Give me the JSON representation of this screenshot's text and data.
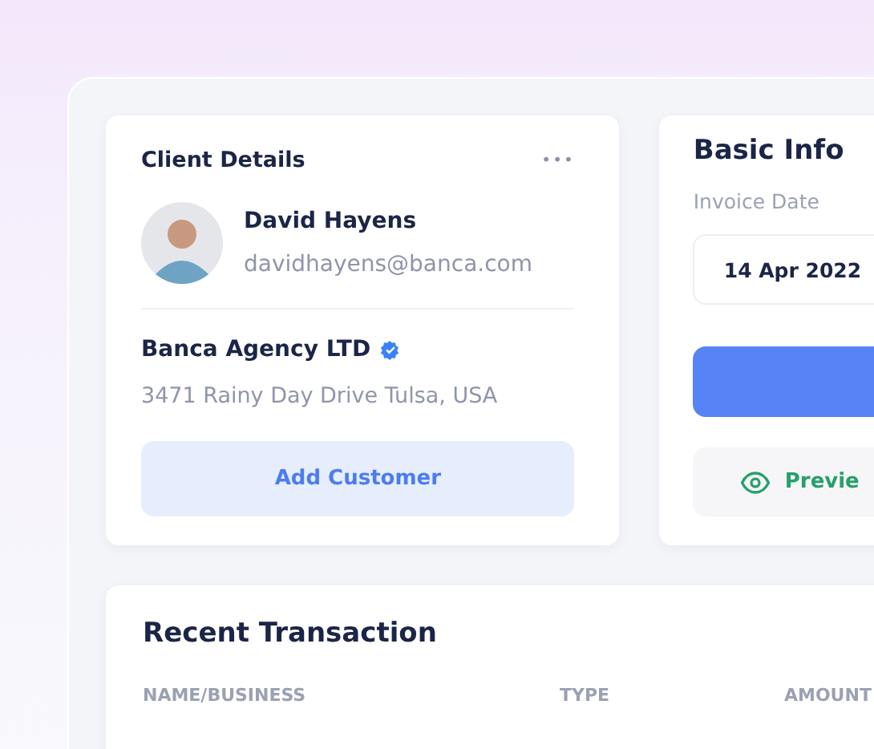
{
  "client_details": {
    "title": "Client Details",
    "menu": "•••",
    "name": "David Hayens",
    "email": "davidhayens@banca.com",
    "company": "Banca Agency LTD",
    "verified": true,
    "address": "3471 Rainy Day Drive Tulsa, USA",
    "button": "Add Customer"
  },
  "basic_info": {
    "title": "Basic Info",
    "date_label": "Invoice Date",
    "date_value": "14 Apr 2022",
    "preview_button": "Previe"
  },
  "recent_transaction": {
    "title": "Recent Transaction",
    "columns": [
      "NAME/BUSINESS",
      "TYPE",
      "AMOUNT"
    ]
  }
}
